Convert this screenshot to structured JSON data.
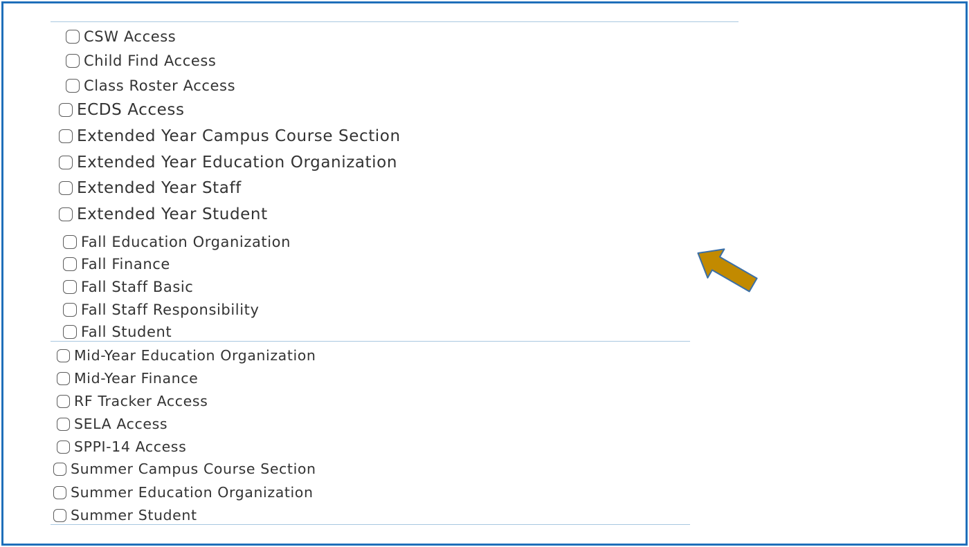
{
  "permissions": {
    "group1": [
      {
        "label": "CSW Access",
        "checked": false
      },
      {
        "label": "Child Find Access",
        "checked": false
      },
      {
        "label": "Class Roster Access",
        "checked": false
      }
    ],
    "group2": [
      {
        "label": "ECDS Access",
        "checked": false
      },
      {
        "label": "Extended Year Campus Course Section",
        "checked": false
      },
      {
        "label": "Extended Year Education Organization",
        "checked": false
      },
      {
        "label": "Extended Year Staff",
        "checked": false
      },
      {
        "label": "Extended Year Student",
        "checked": false
      }
    ],
    "group3": [
      {
        "label": "Fall Education Organization",
        "checked": false
      },
      {
        "label": "Fall Finance",
        "checked": false
      },
      {
        "label": "Fall Staff Basic",
        "checked": false
      },
      {
        "label": "Fall Staff Responsibility",
        "checked": false
      },
      {
        "label": "Fall Student",
        "checked": false
      }
    ],
    "group4": [
      {
        "label": "Mid-Year Education Organization",
        "checked": false
      },
      {
        "label": "Mid-Year Finance",
        "checked": false
      },
      {
        "label": "RF Tracker Access",
        "checked": false
      },
      {
        "label": "SELA Access",
        "checked": false
      },
      {
        "label": "SPPI-14 Access",
        "checked": false
      },
      {
        "label": "Summer Campus Course Section",
        "checked": false
      },
      {
        "label": "Summer Education Organization",
        "checked": false
      },
      {
        "label": "Summer Student",
        "checked": false
      }
    ]
  },
  "annotation": {
    "icon": "pointer-arrow-icon",
    "color": "#c28a00",
    "outline_color": "#3a6fa8"
  },
  "colors": {
    "frame_border": "#1f6fba",
    "divider": "#a8c8e0",
    "text": "#333333"
  }
}
